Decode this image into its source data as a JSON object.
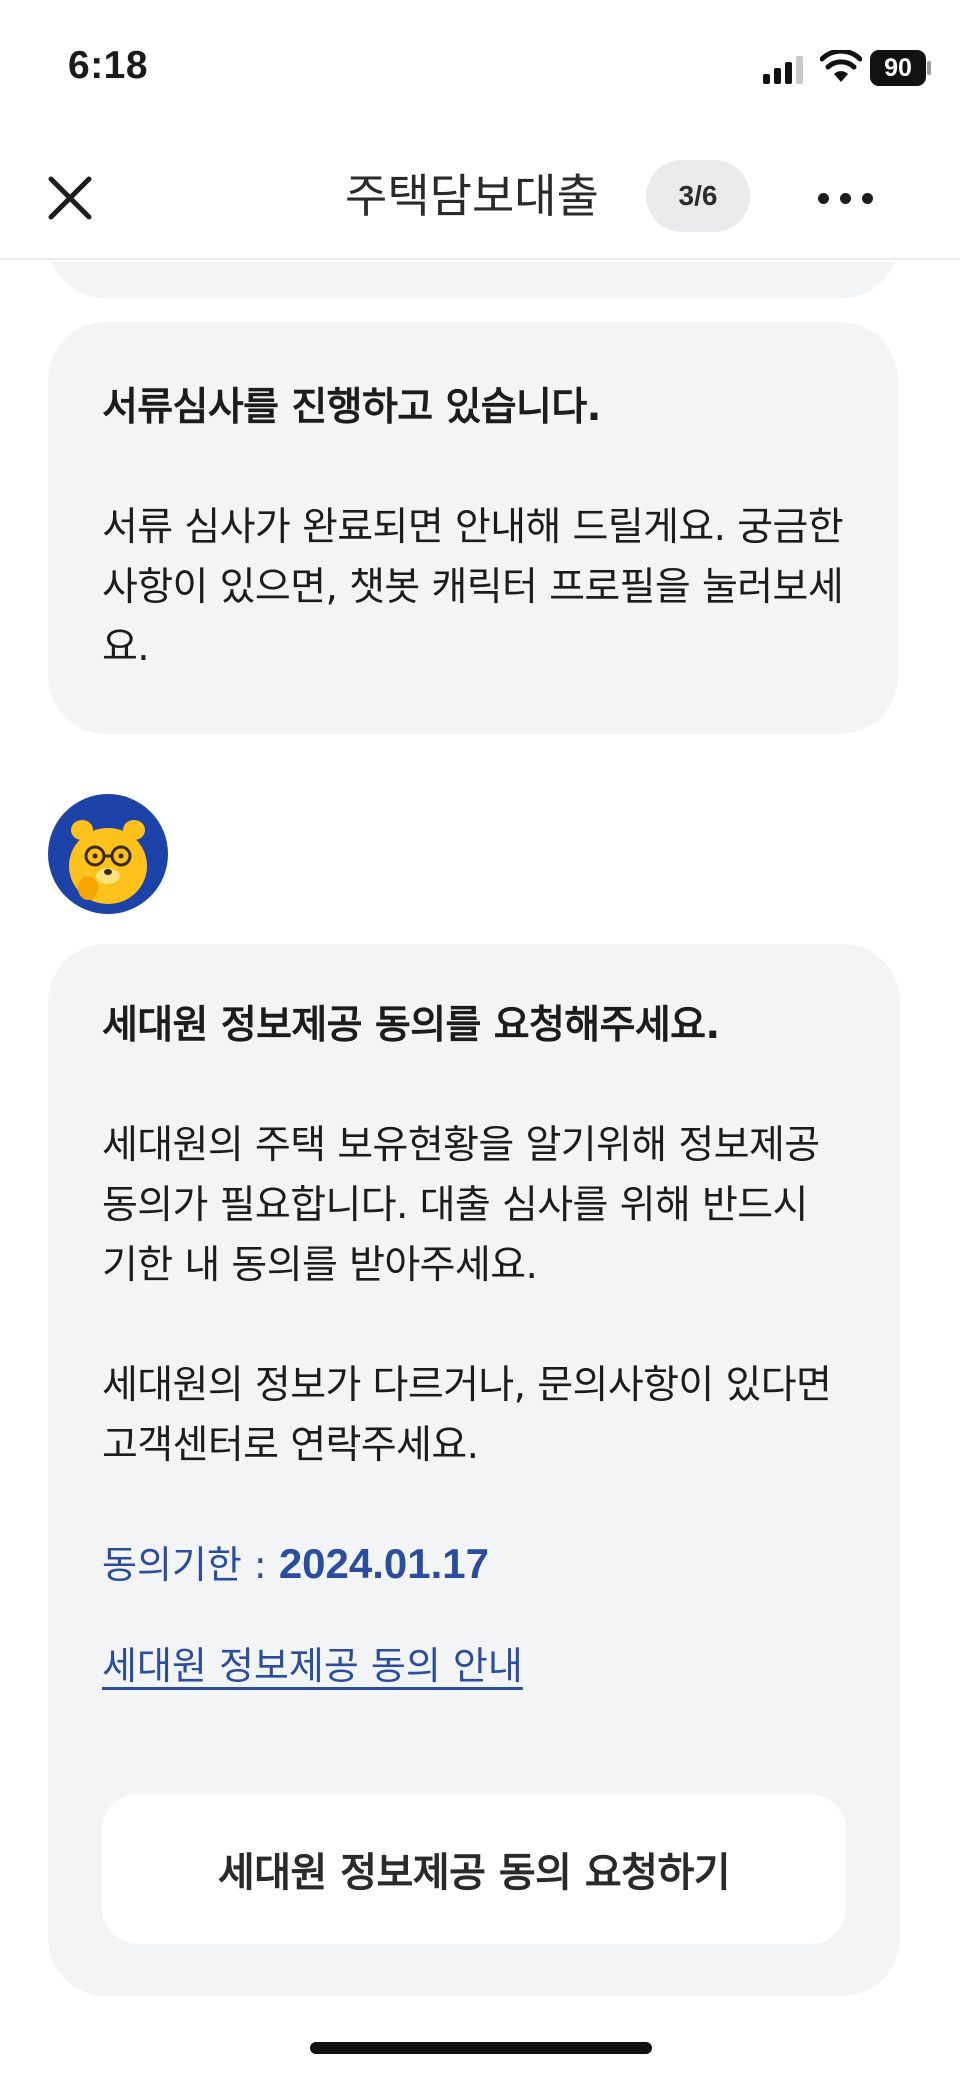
{
  "status_bar": {
    "time": "6:18",
    "battery": "90",
    "icons": [
      "signal-icon",
      "wifi-icon",
      "battery-icon"
    ]
  },
  "nav": {
    "title": "주택담보대출",
    "step": "3/6",
    "icons": [
      "close-icon",
      "more-icon"
    ]
  },
  "messages": {
    "review": {
      "heading": "서류심사를 진행하고 있습니다.",
      "body": "서류 심사가 완료되면 안내해 드릴게요. 궁금한 사항이 있으면, 챗봇 캐릭터 프로필을 눌러보세요."
    },
    "consent": {
      "avatar": "chatbot-avatar",
      "heading": "세대원 정보제공 동의를 요청해주세요.",
      "body1": "세대원의 주택 보유현황을 알기위해 정보제공 동의가 필요합니다. 대출 심사를 위해 반드시 기한 내 동의를 받아주세요.",
      "body2": "세대원의 정보가 다르거나, 문의사항이 있다면 고객센터로 연락주세요.",
      "deadline_label": "동의기한 : ",
      "deadline_date": "2024.01.17",
      "info_link": "세대원 정보제공 동의 안내",
      "button_label": "세대원 정보제공 동의 요청하기"
    }
  },
  "colors": {
    "accent": "#2b4da0",
    "bubble": "#f3f4f6",
    "avatar_bg": "#1d43a8",
    "character": "#ffc11c"
  }
}
